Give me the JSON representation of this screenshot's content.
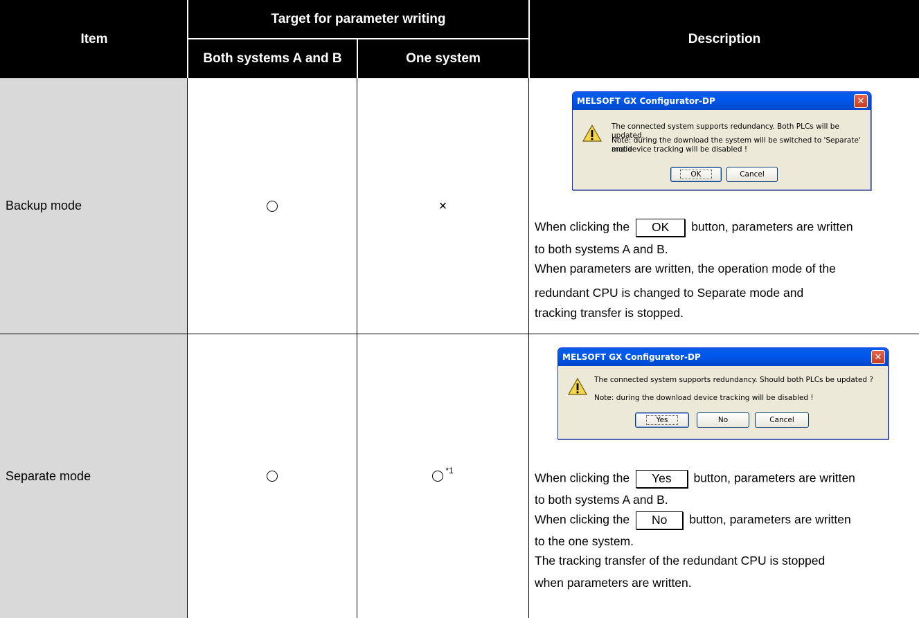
{
  "header": {
    "item": "Item",
    "target": "Target for parameter writing",
    "both": "Both systems A and B",
    "one": "One system",
    "description": "Description"
  },
  "rows": [
    {
      "item": "Backup mode",
      "both_mark": "circle",
      "one_mark": "×",
      "dialog": {
        "title": "MELSOFT GX Configurator-DP",
        "line1": "The connected system supports redundancy. Both PLCs will be updated.",
        "line2": "Note: during the download the system will be switched to 'Separate' mode",
        "line3": "and device tracking will be disabled !",
        "buttons": [
          "OK",
          "Cancel"
        ]
      },
      "text": {
        "p1_before": "When clicking the",
        "p1_button": "OK",
        "p1_after": "button, parameters are written",
        "p1_cont": "to both systems A and B.",
        "p2_l1": "When parameters are written, the operation mode of the",
        "p2_l2": "redundant CPU is changed to Separate mode and",
        "p2_l3": "tracking transfer is stopped."
      }
    },
    {
      "item": "Separate mode",
      "both_mark": "circle",
      "one_mark": "circle",
      "one_note": "*1",
      "dialog": {
        "title": "MELSOFT GX Configurator-DP",
        "line1": "The connected system supports redundancy. Should both PLCs be updated ?",
        "line2": "Note: during the download device tracking will be disabled !",
        "buttons": [
          "Yes",
          "No",
          "Cancel"
        ]
      },
      "text": {
        "p1_before": "When clicking the",
        "p1_button": "Yes",
        "p1_after": "button, parameters are written",
        "p1_cont": "to both systems A and B.",
        "p2_before": "When clicking the",
        "p2_button": "No",
        "p2_after": "button, parameters are written",
        "p2_cont": "to the one system.",
        "p3_l1": "The tracking transfer of the redundant CPU is stopped",
        "p3_l2": "when parameters are written."
      }
    }
  ]
}
